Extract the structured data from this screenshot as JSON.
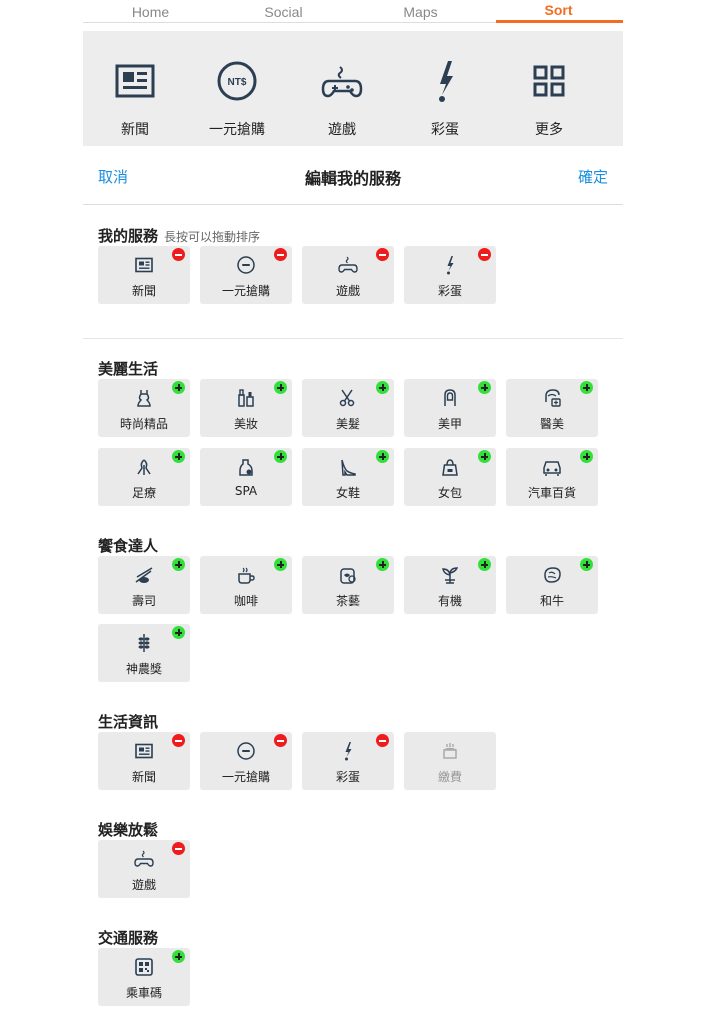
{
  "tabs": [
    "Home",
    "Social",
    "Maps",
    "Sort"
  ],
  "hero": [
    "新聞",
    "一元搶購",
    "遊戲",
    "彩蛋",
    "更多"
  ],
  "bar": {
    "cancel": "取消",
    "title": "編輯我的服務",
    "ok": "確定"
  },
  "my_services": {
    "title": "我的服務",
    "hint": "長按可以拖動排序",
    "items": [
      "新聞",
      "一元搶購",
      "遊戲",
      "彩蛋"
    ]
  },
  "beauty": {
    "title": "美麗生活",
    "items": [
      "時尚精品",
      "美妝",
      "美髮",
      "美甲",
      "醫美",
      "足療",
      "SPA",
      "女鞋",
      "女包",
      "汽車百貨"
    ]
  },
  "food": {
    "title": "饗食達人",
    "items": [
      "壽司",
      "咖啡",
      "茶藝",
      "有機",
      "和牛",
      "神農獎"
    ]
  },
  "life": {
    "title": "生活資訊",
    "items": [
      "新聞",
      "一元搶購",
      "彩蛋",
      "繳費"
    ]
  },
  "ent": {
    "title": "娛樂放鬆",
    "items": [
      "遊戲"
    ]
  },
  "traffic": {
    "title": "交通服務",
    "items": [
      "乘車碼"
    ]
  },
  "hero_icon_text": "NT$",
  "colors": {
    "accent": "#f26d21",
    "link": "#1a8fe0",
    "icon": "#2b3e52",
    "remove": "#ee1c1c",
    "add": "#33e03a"
  }
}
